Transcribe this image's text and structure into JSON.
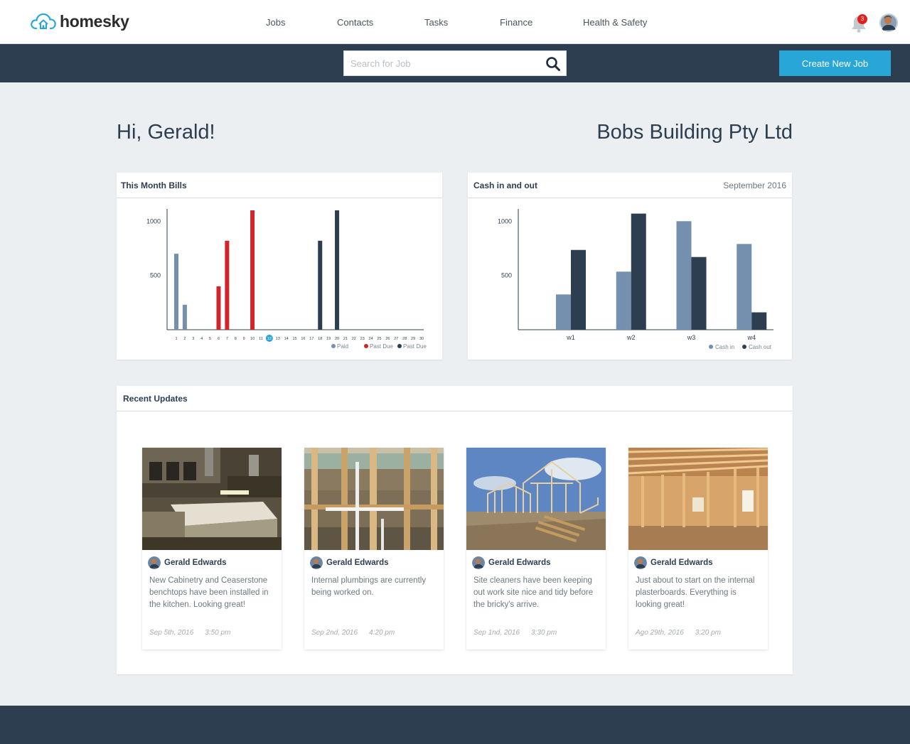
{
  "brand": {
    "name": "homesky",
    "accent": "#29a6d8",
    "dark": "#2c3e50"
  },
  "nav": {
    "items": [
      {
        "label": "Jobs"
      },
      {
        "label": "Contacts"
      },
      {
        "label": "Tasks"
      },
      {
        "label": "Finance"
      },
      {
        "label": "Health & Safety"
      }
    ],
    "notifications_count": "3",
    "bell_icon": "bell-icon"
  },
  "toolbar": {
    "search_placeholder": "Search for Job",
    "search_value": "",
    "create_label": "Create New Job"
  },
  "greeting": "Hi, Gerald!",
  "company": "Bobs Building Pty Ltd",
  "bills_card": {
    "title": "This Month Bills"
  },
  "cash_card": {
    "title": "Cash in and out",
    "period": "September 2016"
  },
  "updates_card": {
    "title": "Recent Updates"
  },
  "chart_data": [
    {
      "type": "bar",
      "title": "This Month Bills",
      "x": [
        1,
        2,
        3,
        4,
        5,
        6,
        7,
        8,
        9,
        10,
        11,
        12,
        13,
        14,
        15,
        16,
        17,
        18,
        19,
        20,
        21,
        22,
        23,
        24,
        25,
        26,
        27,
        28,
        29,
        30
      ],
      "highlight_x": 12,
      "ylim": [
        0,
        1100
      ],
      "yticks": [
        500,
        1000
      ],
      "series": [
        {
          "name": "Paid",
          "color": "#7590ae",
          "points": [
            [
              1,
              700
            ],
            [
              2,
              230
            ]
          ]
        },
        {
          "name": "Past Due",
          "color": "#d0262b",
          "points": [
            [
              6,
              400
            ],
            [
              7,
              820
            ],
            [
              10,
              1100
            ]
          ]
        },
        {
          "name": "Past Due",
          "color": "#2c3e50",
          "points": [
            [
              18,
              820
            ],
            [
              20,
              1100
            ]
          ]
        }
      ],
      "legend": "bottom-right",
      "grid": false
    },
    {
      "type": "bar",
      "title": "Cash in and out",
      "categories": [
        "w1",
        "w2",
        "w3",
        "w4"
      ],
      "ylim": [
        0,
        1100
      ],
      "yticks": [
        500,
        1000
      ],
      "series": [
        {
          "name": "Cash in",
          "color": "#7590ae",
          "values": [
            325,
            535,
            1000,
            790
          ]
        },
        {
          "name": "Cash out",
          "color": "#2c3e50",
          "values": [
            735,
            1070,
            670,
            160
          ]
        }
      ],
      "legend": "bottom-right",
      "grid": false
    }
  ],
  "updates": [
    {
      "author": "Gerald Edwards",
      "text": "New Cabinetry and Ceaserstone benchtops have been installed in the kitchen. Looking great!",
      "date": "Sep 5th, 2016",
      "time": "3:50 pm",
      "image": "kitchen-photo"
    },
    {
      "author": "Gerald Edwards",
      "text": "Internal plumbings are currently being worked on.",
      "date": "Sep 2nd, 2016",
      "time": "4:20 pm",
      "image": "plumbing-photo"
    },
    {
      "author": "Gerald Edwards",
      "text": "Site cleaners have been keeping out work site nice and tidy before the bricky's arrive.",
      "date": "Sep 1nd, 2016",
      "time": "3:30 pm",
      "image": "house-frame-photo"
    },
    {
      "author": "Gerald Edwards",
      "text": "Just about to start on the internal plasterboards. Everything is looking great!",
      "date": "Ago 29th, 2016",
      "time": "3:20 pm",
      "image": "timber-frame-photo"
    }
  ]
}
